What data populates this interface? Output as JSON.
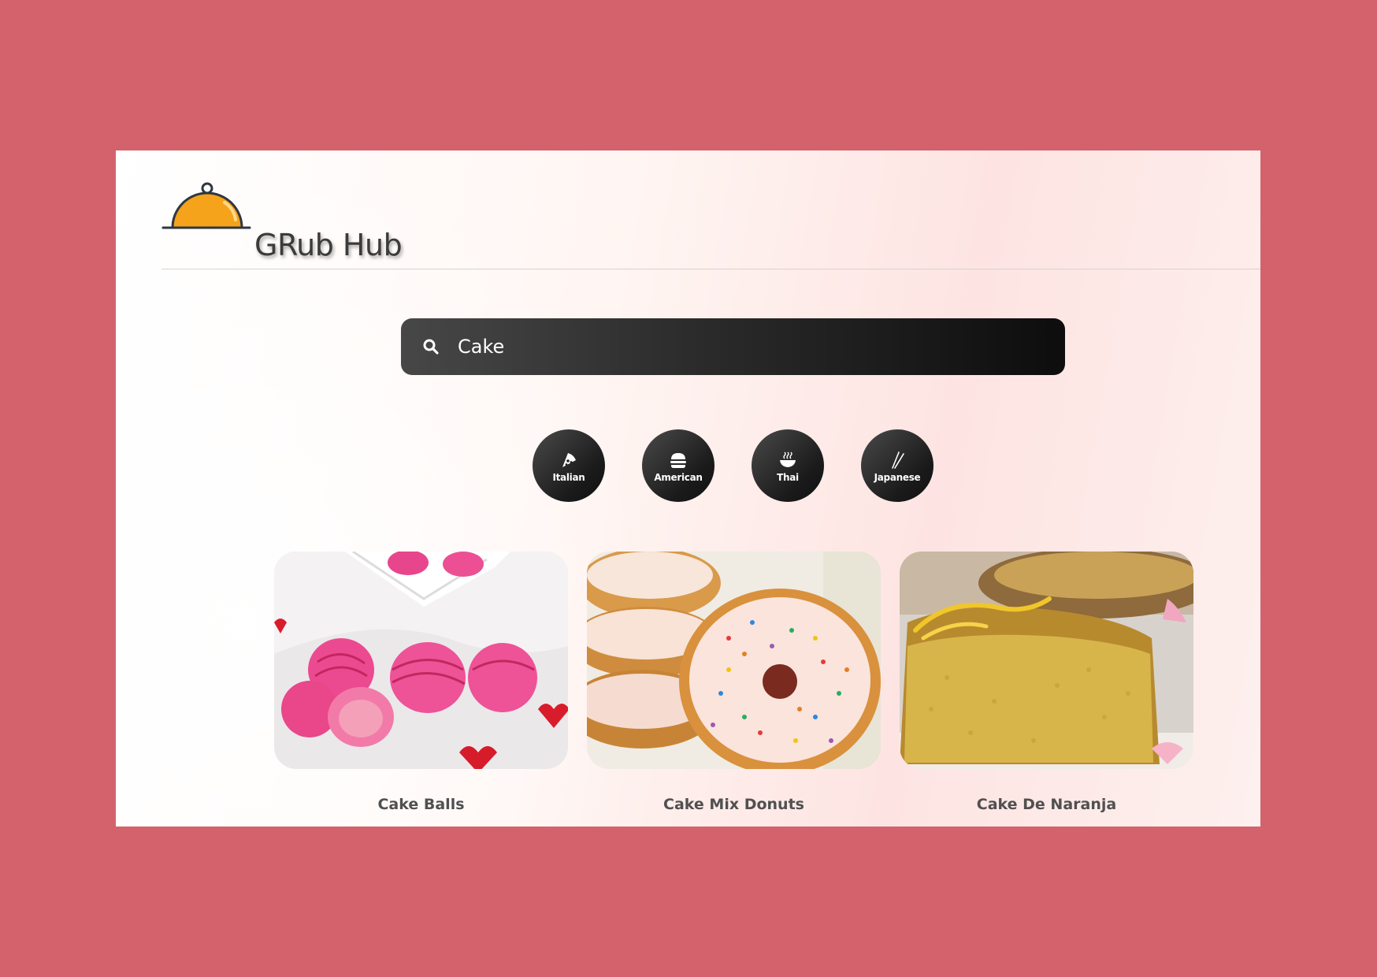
{
  "app": {
    "title": "GRub Hub",
    "logo_icon": "food-cloche-icon"
  },
  "search": {
    "value": "Cake",
    "placeholder": "",
    "icon": "search-icon"
  },
  "cuisines": [
    {
      "label": "Italian",
      "icon": "pizza-icon"
    },
    {
      "label": "American",
      "icon": "burger-icon"
    },
    {
      "label": "Thai",
      "icon": "noodle-bowl-icon"
    },
    {
      "label": "Japanese",
      "icon": "chopsticks-icon"
    }
  ],
  "results": [
    {
      "title": "Cake Balls",
      "image": "pink cake balls with hearts"
    },
    {
      "title": "Cake Mix Donuts",
      "image": "glazed donuts with sprinkles"
    },
    {
      "title": "Cake De Naranja",
      "image": "orange cake slice"
    }
  ],
  "colors": {
    "background": "#d3626d",
    "accent": "#f5a31a",
    "search_bg": "#1a1a1a",
    "text": "#505050"
  }
}
